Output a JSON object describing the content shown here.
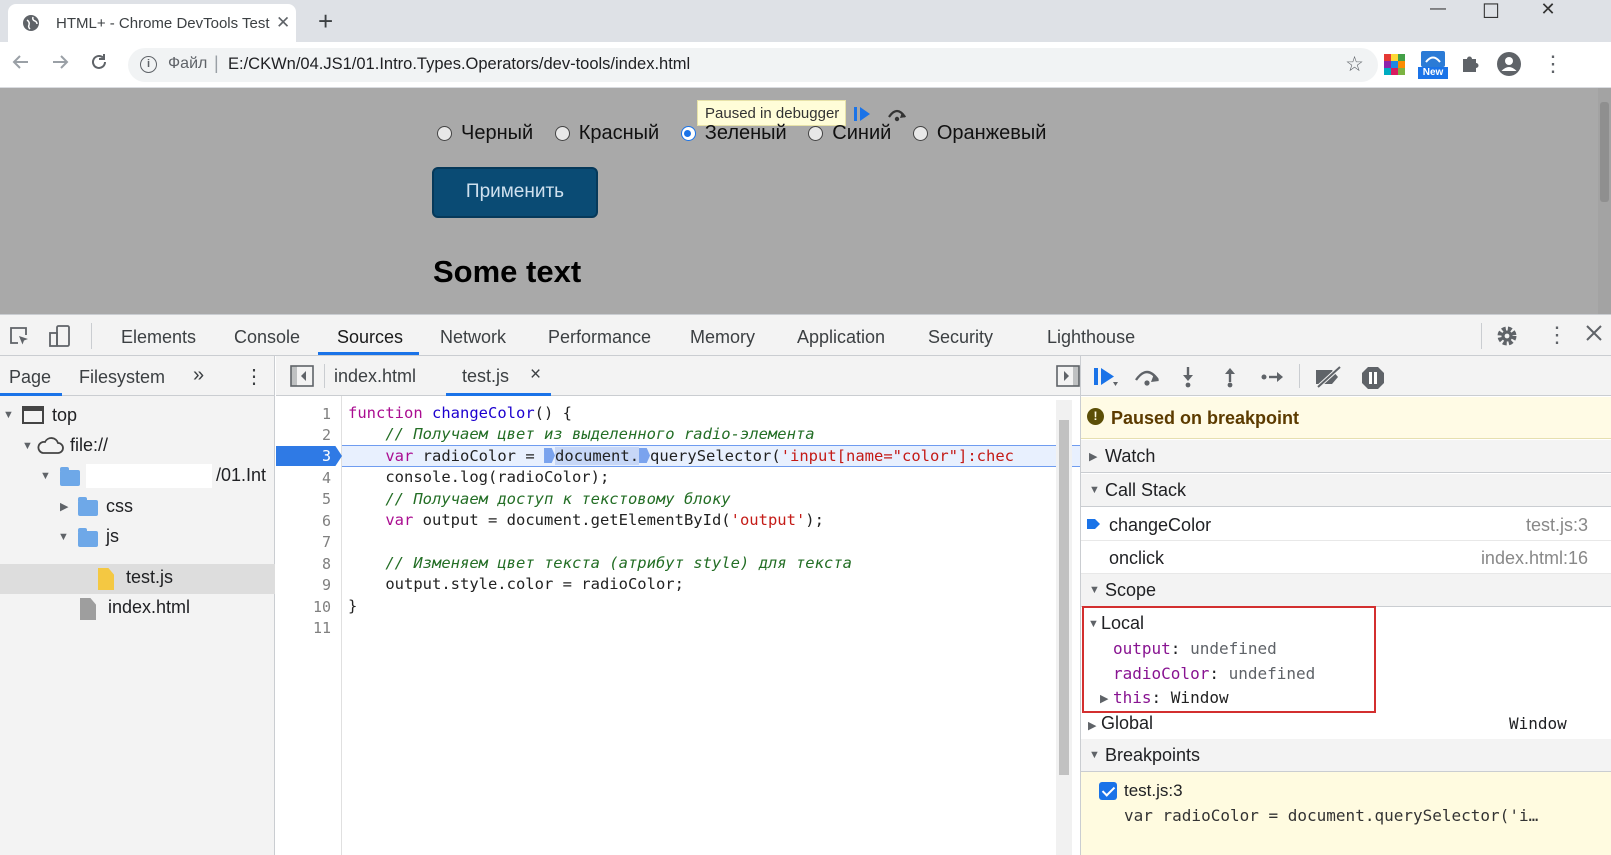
{
  "browser": {
    "tab_title": "HTML+ - Chrome DevTools Test",
    "tab_close": "✕",
    "new_tab": "+",
    "window_buttons": {
      "minimize": "—",
      "maximize": "☐",
      "close": "✕"
    },
    "address": {
      "scheme_label": "Файл",
      "separator": "|",
      "url": "E:/CKWn/04.JS1/01.Intro.Types.Operators/dev-tools/index.html"
    },
    "extensions": {
      "new_badge": "New"
    }
  },
  "page": {
    "paused_label": "Paused in debugger",
    "radios": [
      {
        "label": "Черный",
        "checked": false
      },
      {
        "label": "Красный",
        "checked": false
      },
      {
        "label": "Зеленый",
        "checked": true
      },
      {
        "label": "Синий",
        "checked": false
      },
      {
        "label": "Оранжевый",
        "checked": false
      }
    ],
    "apply_button": "Применить",
    "some_text": "Some text"
  },
  "devtools": {
    "tabs": [
      "Elements",
      "Console",
      "Sources",
      "Network",
      "Performance",
      "Memory",
      "Application",
      "Security",
      "Lighthouse"
    ],
    "active_tab": "Sources",
    "navigator": {
      "tabs": [
        "Page",
        "Filesystem"
      ],
      "more": "»",
      "menu": "⋮",
      "tree": {
        "top": "top",
        "origin": "file://",
        "folder_suffix": "/01.Int",
        "css": "css",
        "js": "js",
        "test_js": "test.js",
        "index_html": "index.html"
      }
    },
    "editor": {
      "tabs": [
        "index.html",
        "test.js"
      ],
      "tab_close": "×",
      "active_tab": "test.js",
      "line_numbers": [
        "1",
        "2",
        "3",
        "4",
        "5",
        "6",
        "7",
        "8",
        "9",
        "10",
        "11"
      ],
      "breakpoint_line": "3",
      "code": {
        "l1_kw": "function",
        "l1_fn": "changeColor",
        "l1_rest": "() {",
        "l2": "// Получаем цвет из выделенного radio-элемента",
        "l3_kw": "var",
        "l3_var": "radioColor",
        "l3_eq": "=",
        "l3_doc": "document",
        "l3_dot": ".",
        "l3_qs": "querySelector(",
        "l3_str": "'input[name=\"color\"]:chec",
        "l4": "console.log(radioColor);",
        "l5": "// Получаем доступ к текстовому блоку",
        "l6_kw": "var",
        "l6_rest": "output = document.getElementById(",
        "l6_str": "'output'",
        "l6_end": ");",
        "l8": "// Изменяем цвет текста (атрибут style) для текста",
        "l9": "output.style.color = radioColor;",
        "l10": "}"
      }
    },
    "debugger": {
      "paused_message": "Paused on breakpoint",
      "watch": "Watch",
      "call_stack": "Call Stack",
      "frames": [
        {
          "name": "changeColor",
          "location": "test.js:3"
        },
        {
          "name": "onclick",
          "location": "index.html:16"
        }
      ],
      "scope": "Scope",
      "local": "Local",
      "vars": [
        {
          "name": "output",
          "value": "undefined"
        },
        {
          "name": "radioColor",
          "value": "undefined"
        },
        {
          "name": "this",
          "value": "Window"
        }
      ],
      "global": "Global",
      "global_value": "Window",
      "breakpoints": "Breakpoints",
      "breakpoint_item": {
        "label": "test.js:3",
        "code": "var radioColor = document.querySelector('i…",
        "checked": true
      }
    }
  }
}
